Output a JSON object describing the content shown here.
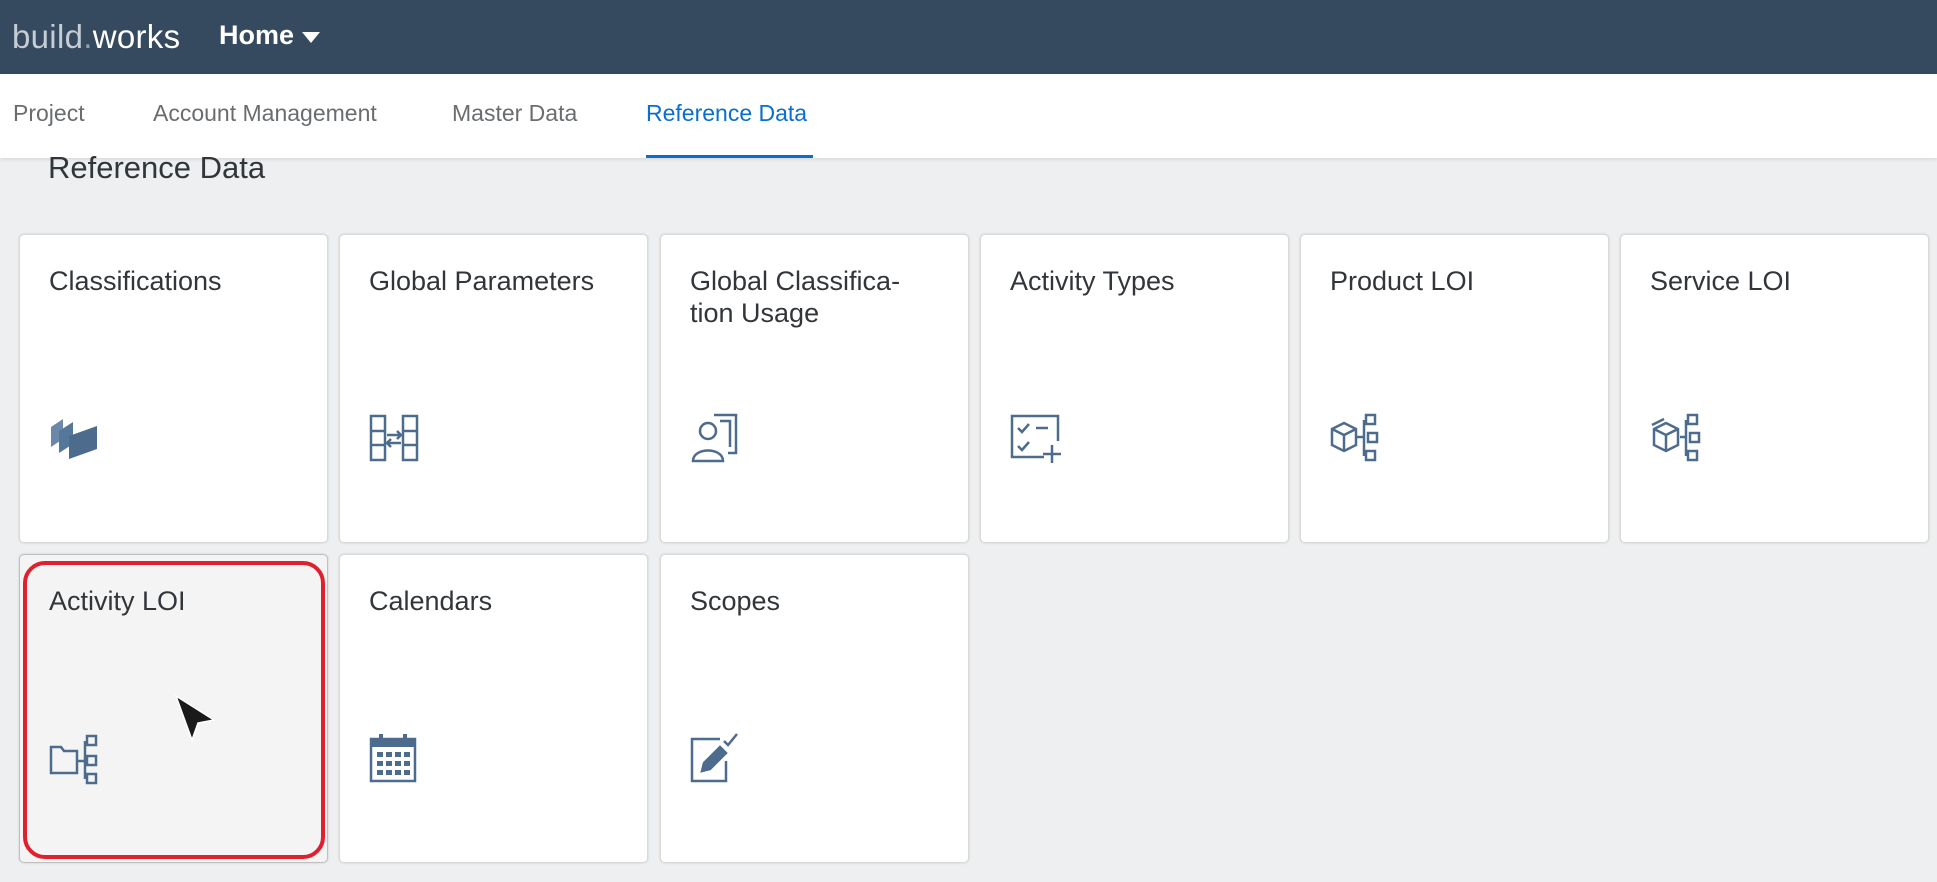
{
  "shell": {
    "logo_part1": "build",
    "logo_dot": ".",
    "logo_part2": "works",
    "home_menu_label": "Home"
  },
  "tabs": [
    {
      "label": "Project"
    },
    {
      "label": "Account Management"
    },
    {
      "label": "Master Data"
    },
    {
      "label": "Reference Data",
      "selected": true
    }
  ],
  "section_title": "Reference Data",
  "tiles": [
    {
      "title": "Classifications",
      "icon": "classifications-icon"
    },
    {
      "title": "Global Parameters",
      "icon": "global-parameters-icon"
    },
    {
      "title": "Global Classifica-\ntion Usage",
      "icon": "classification-usage-icon"
    },
    {
      "title": "Activity Types",
      "icon": "activity-types-icon"
    },
    {
      "title": "Product LOI",
      "icon": "product-loi-icon"
    },
    {
      "title": "Service LOI",
      "icon": "service-loi-icon"
    },
    {
      "title": "Activity LOI",
      "icon": "activity-loi-icon",
      "hovered": true
    },
    {
      "title": "Calendars",
      "icon": "calendar-icon"
    },
    {
      "title": "Scopes",
      "icon": "scopes-icon"
    }
  ],
  "colors": {
    "shell_bg": "#354a5f",
    "accent": "#0a6ed1",
    "icon": "#4d6b8c",
    "highlight": "#e0202f"
  }
}
